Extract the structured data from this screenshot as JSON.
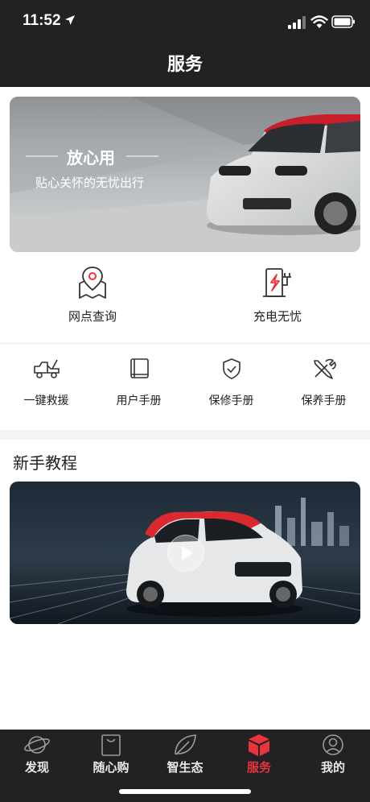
{
  "status_bar": {
    "time": "11:52"
  },
  "nav": {
    "title": "服务"
  },
  "banner": {
    "title": "放心用",
    "subtitle": "贴心关怀的无忧出行"
  },
  "top_services": [
    {
      "label": "网点查询",
      "icon": "map-location-icon"
    },
    {
      "label": "充电无忧",
      "icon": "charging-station-icon"
    }
  ],
  "services": [
    {
      "label": "一键救援",
      "icon": "tow-truck-icon"
    },
    {
      "label": "用户手册",
      "icon": "manual-book-icon"
    },
    {
      "label": "保修手册",
      "icon": "shield-check-icon"
    },
    {
      "label": "保养手册",
      "icon": "wrench-screwdriver-icon"
    }
  ],
  "tutorial": {
    "section_title": "新手教程",
    "video_icon": "play-icon"
  },
  "tab_bar": {
    "items": [
      {
        "label": "发现",
        "icon": "planet-icon"
      },
      {
        "label": "随心购",
        "icon": "shopping-bag-icon"
      },
      {
        "label": "智生态",
        "icon": "leaf-icon"
      },
      {
        "label": "服务",
        "icon": "service-box-icon"
      },
      {
        "label": "我的",
        "icon": "user-icon"
      }
    ],
    "active_index": 3
  },
  "colors": {
    "accent": "#e8343c",
    "dark_bar": "#222225"
  }
}
